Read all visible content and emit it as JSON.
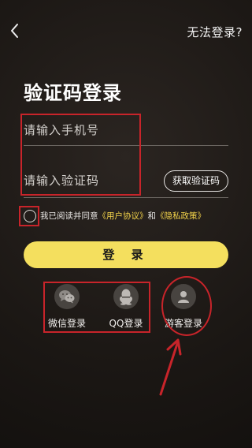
{
  "header": {
    "help_link": "无法登录?"
  },
  "page": {
    "title": "验证码登录"
  },
  "form": {
    "phone_placeholder": "请输入手机号",
    "code_placeholder": "请输入验证码",
    "get_code_label": "获取验证码"
  },
  "agreement": {
    "prefix": "我已阅读并同意",
    "user_agreement": "《用户协议》",
    "joiner": "和",
    "privacy_policy": "《隐私政策》",
    "checked": false
  },
  "login_button": {
    "label": "登 录"
  },
  "social": {
    "wechat_label": "微信登录",
    "qq_label": "QQ登录",
    "guest_label": "游客登录"
  },
  "colors": {
    "accent_yellow": "#f4df5e",
    "link_yellow": "#f3d34a",
    "annotation_red": "#c8242a"
  }
}
